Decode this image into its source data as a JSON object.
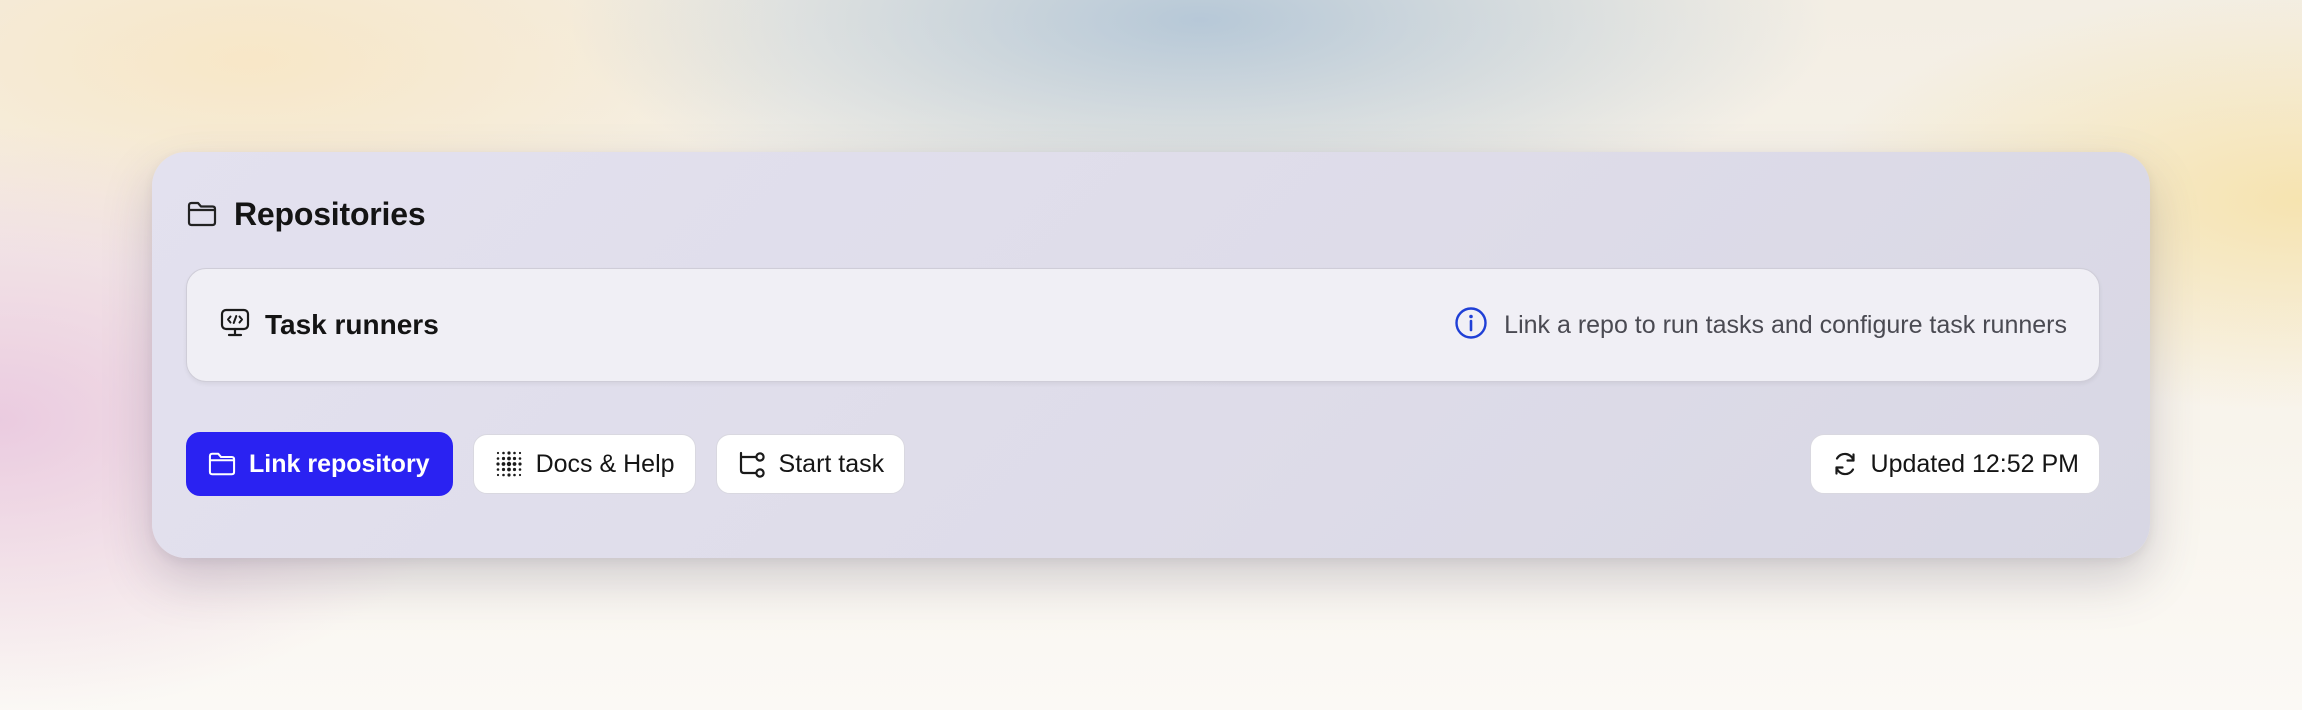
{
  "card": {
    "title": "Repositories",
    "title_icon": "folder-icon"
  },
  "panel": {
    "title": "Task runners",
    "title_icon": "code-monitor-icon",
    "hint": "Link a repo to run tasks and configure task runners",
    "hint_icon": "info-icon"
  },
  "actions": {
    "link_repository": {
      "label": "Link repository",
      "icon": "folder-icon"
    },
    "docs_help": {
      "label": "Docs & Help",
      "icon": "dot-grid-icon"
    },
    "start_task": {
      "label": "Start task",
      "icon": "workflow-icon"
    },
    "updated": {
      "label": "Updated 12:52 PM",
      "icon": "refresh-icon"
    }
  },
  "colors": {
    "accent": "#2a22f2",
    "info": "#1f3fd6"
  }
}
